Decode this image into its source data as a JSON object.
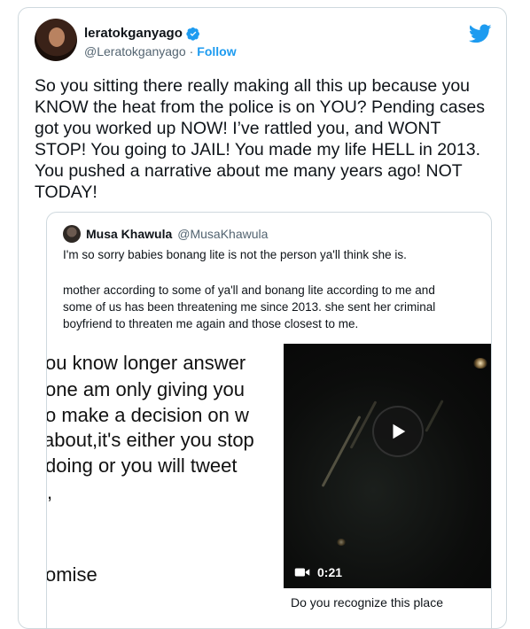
{
  "tweet": {
    "display_name": "leratokganyago",
    "handle": "@Leratokganyago",
    "separator": "·",
    "follow_label": "Follow",
    "text": "So you sitting there really making all this up because you\nKNOW the heat from the police is on YOU? Pending cases\ngot you worked up NOW! I’ve rattled you, and WONT\nSTOP! You going to JAIL! You made my life HELL in 2013.\nYou pushed a narrative about me many years ago! NOT\nTODAY!",
    "accent_color": "#1d9bf0"
  },
  "quote": {
    "display_name": "Musa Khawula",
    "handle": "@MusaKhawula",
    "text1": "I'm so sorry babies bonang lite is not the person ya'll think she is.",
    "text2": "mother according to some of ya'll and bonang lite according to me and\nsome of us has been threatening me since 2013. she sent her criminal\nboyfriend to threaten me again and those closest to me.",
    "image_lines": [
      "ou know longer answer",
      "one am only giving you",
      "o make a decision on w",
      "about,it's either you stop",
      " doing or you will tweet",
      ",",
      "omise"
    ],
    "video_duration": "0:21",
    "footer_text": "Do you recognize this place"
  },
  "icons": [
    "verified-badge-icon",
    "twitter-bird-icon",
    "play-icon",
    "video-camera-icon"
  ]
}
